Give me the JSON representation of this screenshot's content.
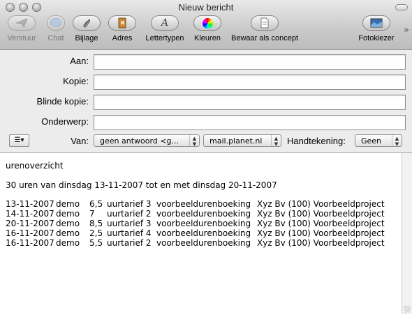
{
  "window": {
    "title": "Nieuw bericht"
  },
  "toolbar": {
    "send": "Verstuur",
    "chat": "Chat",
    "attach": "Bijlage",
    "address": "Adres",
    "fonts": "Lettertypen",
    "colors": "Kleuren",
    "save_draft": "Bewaar als concept",
    "photo_browser": "Fotokiezer",
    "overflow": "»"
  },
  "header": {
    "to_label": "Aan:",
    "to_value": "",
    "cc_label": "Kopie:",
    "cc_value": "",
    "bcc_label": "Blinde kopie:",
    "bcc_value": "",
    "subject_label": "Onderwerp:",
    "subject_value": "",
    "from_label": "Van:",
    "from_value": "geen antwoord <g...",
    "account_value": "mail.planet.nl",
    "signature_label": "Handtekening:",
    "signature_value": "Geen"
  },
  "message": {
    "line1": "urenoverzicht",
    "line2": "30 uren van dinsdag 13-11-2007 tot en met dinsdag 20-11-2007",
    "rows": [
      [
        "13-11-2007",
        "demo",
        "6,5",
        "uurtarief 3",
        "voorbeeldurenboeking",
        "Xyz Bv (100) Voorbeeldproject"
      ],
      [
        "14-11-2007",
        "demo",
        "7",
        "uurtarief 2",
        "voorbeeldurenboeking",
        "Xyz Bv (100) Voorbeeldproject"
      ],
      [
        "20-11-2007",
        "demo",
        "8,5",
        "uurtarief 3",
        "voorbeeldurenboeking",
        "Xyz Bv (100) Voorbeeldproject"
      ],
      [
        "16-11-2007",
        "demo",
        "2,5",
        "uurtarief 4",
        "voorbeeldurenboeking",
        "Xyz Bv (100) Voorbeeldproject"
      ],
      [
        "16-11-2007",
        "demo",
        "5,5",
        "uurtarief 2",
        "voorbeeldurenboeking",
        "Xyz Bv (100) Voorbeeldproject"
      ]
    ]
  }
}
